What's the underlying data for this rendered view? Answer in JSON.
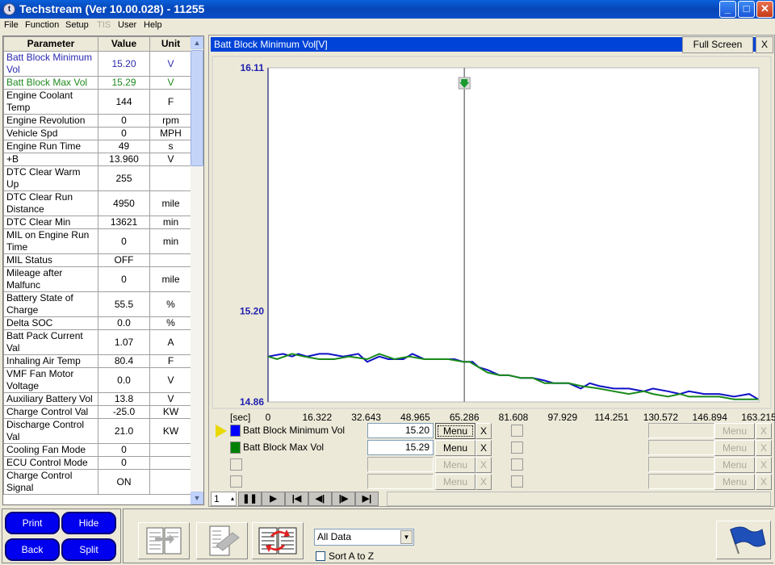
{
  "window": {
    "title": "Techstream (Ver 10.00.028) - 11255",
    "buttons": {
      "minimize": "_",
      "maximize": "□",
      "close": "✕"
    }
  },
  "menu": {
    "items": [
      {
        "label": "File",
        "enabled": true
      },
      {
        "label": "Function",
        "enabled": true
      },
      {
        "label": "Setup",
        "enabled": true
      },
      {
        "label": "TIS",
        "enabled": false
      },
      {
        "label": "User",
        "enabled": true
      },
      {
        "label": "Help",
        "enabled": true
      }
    ]
  },
  "params": {
    "headers": {
      "parameter": "Parameter",
      "value": "Value",
      "unit": "Unit"
    },
    "rows": [
      {
        "name": "Batt Block Minimum Vol",
        "value": "15.20",
        "unit": "V",
        "color": "#2a2ab0"
      },
      {
        "name": "Batt Block Max Vol",
        "value": "15.29",
        "unit": "V",
        "color": "#1e8a1e"
      },
      {
        "name": "Engine Coolant Temp",
        "value": "144",
        "unit": "F"
      },
      {
        "name": "Engine Revolution",
        "value": "0",
        "unit": "rpm"
      },
      {
        "name": "Vehicle Spd",
        "value": "0",
        "unit": "MPH"
      },
      {
        "name": "Engine Run Time",
        "value": "49",
        "unit": "s"
      },
      {
        "name": "+B",
        "value": "13.960",
        "unit": "V"
      },
      {
        "name": "DTC Clear Warm Up",
        "value": "255",
        "unit": ""
      },
      {
        "name": "DTC Clear Run Distance",
        "value": "4950",
        "unit": "mile"
      },
      {
        "name": "DTC Clear Min",
        "value": "13621",
        "unit": "min"
      },
      {
        "name": "MIL on Engine Run Time",
        "value": "0",
        "unit": "min"
      },
      {
        "name": "MIL Status",
        "value": "OFF",
        "unit": ""
      },
      {
        "name": "Mileage after Malfunc",
        "value": "0",
        "unit": "mile"
      },
      {
        "name": "Battery State of Charge",
        "value": "55.5",
        "unit": "%"
      },
      {
        "name": "Delta SOC",
        "value": "0.0",
        "unit": "%"
      },
      {
        "name": "Batt Pack Current Val",
        "value": "1.07",
        "unit": "A"
      },
      {
        "name": "Inhaling Air Temp",
        "value": "80.4",
        "unit": "F"
      },
      {
        "name": "VMF Fan Motor Voltage",
        "value": "0.0",
        "unit": "V"
      },
      {
        "name": "Auxiliary Battery Vol",
        "value": "13.8",
        "unit": "V"
      },
      {
        "name": "Charge Control Val",
        "value": "-25.0",
        "unit": "KW"
      },
      {
        "name": "Discharge Control Val",
        "value": "21.0",
        "unit": "KW"
      },
      {
        "name": "Cooling Fan Mode",
        "value": "0",
        "unit": ""
      },
      {
        "name": "ECU Control Mode",
        "value": "0",
        "unit": ""
      },
      {
        "name": "Charge Control Signal",
        "value": "ON",
        "unit": ""
      }
    ]
  },
  "graph": {
    "title": "Batt Block Minimum Vol[V]",
    "full_screen_label": "Full Screen",
    "close_label": "X",
    "x_unit_label": "[sec]",
    "cursor_marker_icon": "green-down-arrow"
  },
  "chart_data": {
    "type": "line",
    "title": "Batt Block Minimum Vol[V]",
    "xlabel": "[sec]",
    "ylabel": "",
    "xlim": [
      0,
      163.215
    ],
    "ylim": [
      14.86,
      16.11
    ],
    "yticks": [
      "16.11",
      "15.20",
      "14.86"
    ],
    "xticks": [
      "0",
      "16.322",
      "32.643",
      "48.965",
      "65.286",
      "81.608",
      "97.929",
      "114.251",
      "130.572",
      "146.894",
      "163.215"
    ],
    "cursor_x": 65.286,
    "grid": false,
    "series": [
      {
        "name": "Batt Block Minimum Vol",
        "color": "#1010c8",
        "x": [
          0,
          5,
          8,
          10,
          13,
          17,
          20,
          25,
          30,
          33,
          37,
          40,
          45,
          48,
          52,
          55,
          60,
          62,
          65,
          68,
          70,
          73,
          77,
          80,
          84,
          88,
          92,
          95,
          100,
          104,
          107,
          110,
          115,
          120,
          125,
          128,
          133,
          137,
          140,
          145,
          150,
          155,
          160,
          163
        ],
        "y": [
          15.03,
          15.04,
          15.03,
          15.04,
          15.03,
          15.04,
          15.04,
          15.03,
          15.04,
          15.01,
          15.03,
          15.02,
          15.02,
          15.04,
          15.02,
          15.02,
          15.02,
          15.02,
          15.01,
          15.01,
          14.99,
          14.98,
          14.96,
          14.96,
          14.95,
          14.95,
          14.94,
          14.93,
          14.93,
          14.91,
          14.93,
          14.92,
          14.91,
          14.91,
          14.9,
          14.91,
          14.9,
          14.89,
          14.9,
          14.89,
          14.89,
          14.88,
          14.89,
          14.87
        ]
      },
      {
        "name": "Batt Block Max Vol",
        "color": "#1a8a1a",
        "x": [
          0,
          3,
          8,
          12,
          17,
          22,
          27,
          33,
          37,
          42,
          47,
          52,
          56,
          60,
          65,
          67,
          70,
          73,
          77,
          80,
          84,
          88,
          92,
          95,
          100,
          104,
          110,
          115,
          120,
          125,
          128,
          133,
          137,
          140,
          145,
          150,
          155,
          160,
          163
        ],
        "y": [
          15.03,
          15.02,
          15.04,
          15.03,
          15.02,
          15.02,
          15.03,
          15.02,
          15.04,
          15.02,
          15.03,
          15.02,
          15.02,
          15.02,
          15.01,
          15.01,
          14.99,
          14.97,
          14.96,
          14.96,
          14.95,
          14.95,
          14.93,
          14.93,
          14.93,
          14.92,
          14.91,
          14.9,
          14.89,
          14.9,
          14.89,
          14.88,
          14.89,
          14.88,
          14.88,
          14.88,
          14.87,
          14.87,
          14.87
        ]
      }
    ]
  },
  "legend": {
    "rows": [
      {
        "label": "Batt Block Minimum Vol",
        "value": "15.20",
        "menu": "Menu",
        "x": "X",
        "color": "#0000ff",
        "selected": true,
        "enabled": true
      },
      {
        "label": "Batt Block Max Vol",
        "value": "15.29",
        "menu": "Menu",
        "x": "X",
        "color": "#008000",
        "selected": false,
        "enabled": true
      },
      {
        "label": "",
        "value": "",
        "menu": "Menu",
        "x": "X",
        "enabled": false
      },
      {
        "label": "",
        "value": "",
        "menu": "Menu",
        "x": "X",
        "enabled": false
      }
    ],
    "right_rows": [
      {
        "menu": "Menu",
        "x": "X"
      },
      {
        "menu": "Menu",
        "x": "X"
      },
      {
        "menu": "Menu",
        "x": "X"
      },
      {
        "menu": "Menu",
        "x": "X"
      }
    ]
  },
  "playback": {
    "speed_value": "1",
    "buttons": [
      "pause",
      "play",
      "first",
      "step-back",
      "step-forward",
      "last"
    ]
  },
  "bottom": {
    "print_label": "Print",
    "hide_label": "Hide",
    "back_label": "Back",
    "split_label": "Split",
    "filter_select_value": "All Data",
    "sort_label": "Sort A to Z",
    "sort_checked": false
  }
}
